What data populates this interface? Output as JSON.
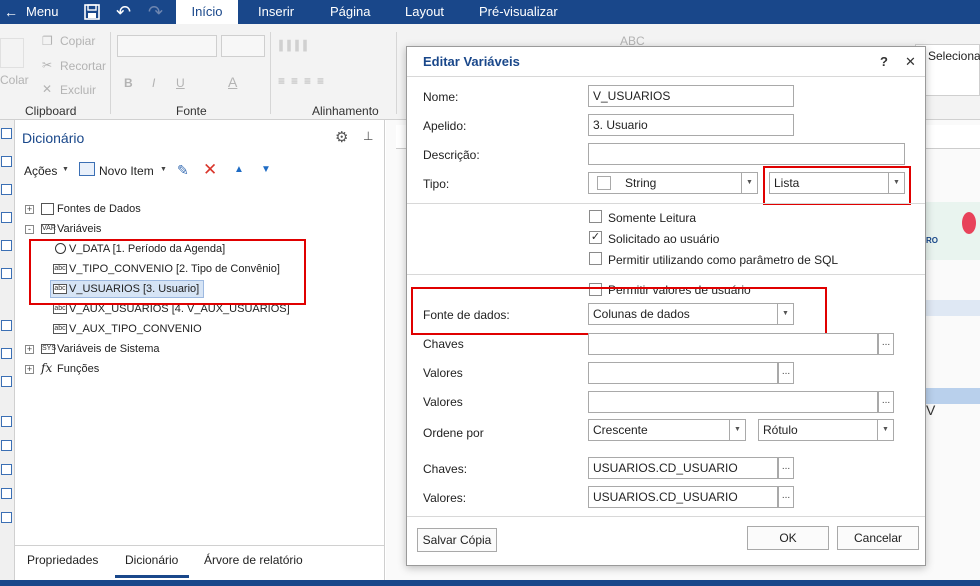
{
  "topbar": {
    "menu": "Menu",
    "tabs": [
      "Início",
      "Inserir",
      "Página",
      "Layout",
      "Pré-visualizar"
    ],
    "active_tab": "Início"
  },
  "ribbon": {
    "clipboard": {
      "copy": "Copiar",
      "cut": "Recortar",
      "delete": "Excluir",
      "paste": "Colar",
      "group": "Clipboard"
    },
    "font": {
      "group": "Fonte",
      "bold": "B",
      "italic": "I",
      "underline": "U",
      "color": "A"
    },
    "align": {
      "group": "Alinhamento"
    },
    "abc": "ABC",
    "selecionar": "Selecionar"
  },
  "dictionary": {
    "title": "Dicionário",
    "actions": "Ações",
    "new_item": "Novo Item",
    "tree": {
      "data_sources": "Fontes de Dados",
      "variables": "Variáveis",
      "items": [
        {
          "icon": "clock",
          "label": "V_DATA [1. Período da Agenda]"
        },
        {
          "icon": "abc",
          "label": "V_TIPO_CONVENIO [2. Tipo de Convênio]"
        },
        {
          "icon": "abc",
          "label": "V_USUARIOS [3. Usuario]"
        },
        {
          "icon": "abc",
          "label": "V_AUX_USUARIOS [4. V_AUX_USUARIOS]"
        },
        {
          "icon": "abc",
          "label": "V_AUX_TIPO_CONVENIO"
        }
      ],
      "system_variables": "Variáveis de Sistema",
      "functions": "Funções"
    },
    "bottom_tabs": [
      "Propriedades",
      "Dicionário",
      "Árvore de relatório"
    ],
    "active_bottom_tab": "Dicionário"
  },
  "dialog": {
    "title": "Editar Variáveis",
    "help": "?",
    "close": "✕",
    "labels": {
      "name": "Nome:",
      "alias": "Apelido:",
      "description": "Descrição:",
      "type": "Tipo:",
      "datasource": "Fonte de dados:",
      "keys": "Chaves",
      "values1": "Valores",
      "values2": "Valores",
      "sort": "Ordene por",
      "keys2": "Chaves:",
      "values3": "Valores:"
    },
    "fields": {
      "name": "V_USUARIOS",
      "alias": "3. Usuario",
      "description": "",
      "type": "String",
      "type_kind": "Lista",
      "datasource": "Colunas de dados",
      "keys": "",
      "values1": "",
      "values2": "",
      "sort_order": "Crescente",
      "sort_by": "Rótulo",
      "keys_col": "USUARIOS.CD_USUARIO",
      "values_col": "USUARIOS.CD_USUARIO"
    },
    "checkboxes": [
      {
        "label": "Somente Leitura",
        "checked": false
      },
      {
        "label": "Solicitado ao usuário",
        "checked": true
      },
      {
        "label": "Permitir utilizando como parâmetro de SQL",
        "checked": false
      },
      {
        "label": "Permitir valores de usuário",
        "checked": false
      }
    ],
    "dots": "...",
    "buttons": {
      "save_copy": "Salvar Cópia",
      "ok": "OK",
      "cancel": "Cancelar"
    }
  },
  "report": {
    "side_text": "RO",
    "side_letter": "V"
  },
  "colors": {
    "brand": "#19478a",
    "highlight_red": "#e00000",
    "selected_row": "#d6e4f5"
  }
}
